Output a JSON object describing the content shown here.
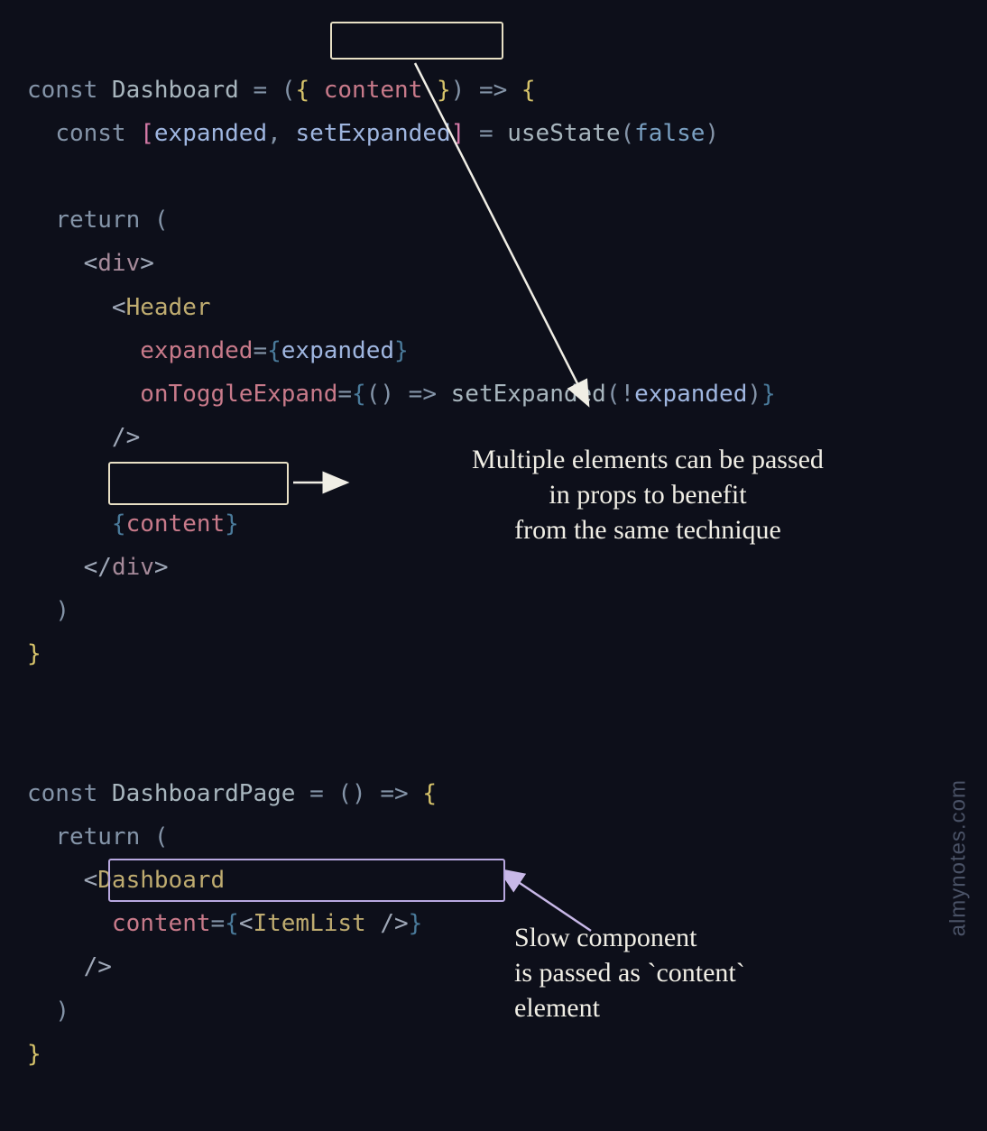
{
  "code": {
    "l1": {
      "const": "const ",
      "fn": "Dashboard ",
      "eq": "= (",
      "b1": "{ ",
      "prop": "content ",
      "b2": "}",
      "cp": ") ",
      "arrow": "=> ",
      "ob": "{"
    },
    "l2": {
      "const": "const ",
      "lb": "[",
      "v1": "expanded",
      "c1": ", ",
      "v2": "setExpanded",
      "rb": "] ",
      "eq": "= ",
      "fn": "useState",
      "op": "(",
      "bool": "false",
      "cp": ")"
    },
    "l3": {
      "ret": "return ",
      "op": "("
    },
    "l4": {
      "lt": "<",
      "div": "div",
      "gt": ">"
    },
    "l5": {
      "lt": "<",
      "comp": "Header"
    },
    "l6": {
      "prop": "expanded",
      "eq": "=",
      "lb": "{",
      "var": "expanded",
      "rb": "}"
    },
    "l7": {
      "prop": "onToggleExpand",
      "eq": "=",
      "lb": "{",
      "fn": "() ",
      "arrow": "=> ",
      "call": "setExpanded",
      "op": "(",
      "bang": "!",
      "var": "expanded",
      "cp": ")",
      "rb": "}"
    },
    "l8": {
      "close": "/>"
    },
    "l9": {
      "lb": "{",
      "var": "content",
      "rb": "}"
    },
    "l10": {
      "lt": "</",
      "div": "div",
      "gt": ">"
    },
    "l11": {
      "cp": ")"
    },
    "l12": {
      "cb": "}"
    },
    "l13": {
      "const": "const ",
      "fn": "DashboardPage ",
      "eq": "= () ",
      "arrow": "=> ",
      "ob": "{"
    },
    "l14": {
      "ret": "return ",
      "op": "("
    },
    "l15": {
      "lt": "<",
      "comp": "Dashboard"
    },
    "l16": {
      "prop": "content",
      "eq": "=",
      "lb": "{",
      "lt2": "<",
      "comp": "ItemList ",
      "close": "/>",
      "rb": "}"
    },
    "l17": {
      "close": "/>"
    },
    "l18": {
      "cp": ")"
    },
    "l19": {
      "cb": "}"
    }
  },
  "annotations": {
    "a1_l1": "Multiple elements can be passed",
    "a1_l2": "in props to benefit",
    "a1_l3": "from the same technique",
    "a2_l1": "Slow component",
    "a2_l2": "is passed as `content`",
    "a2_l3": "element"
  },
  "watermark": "almynotes.com"
}
